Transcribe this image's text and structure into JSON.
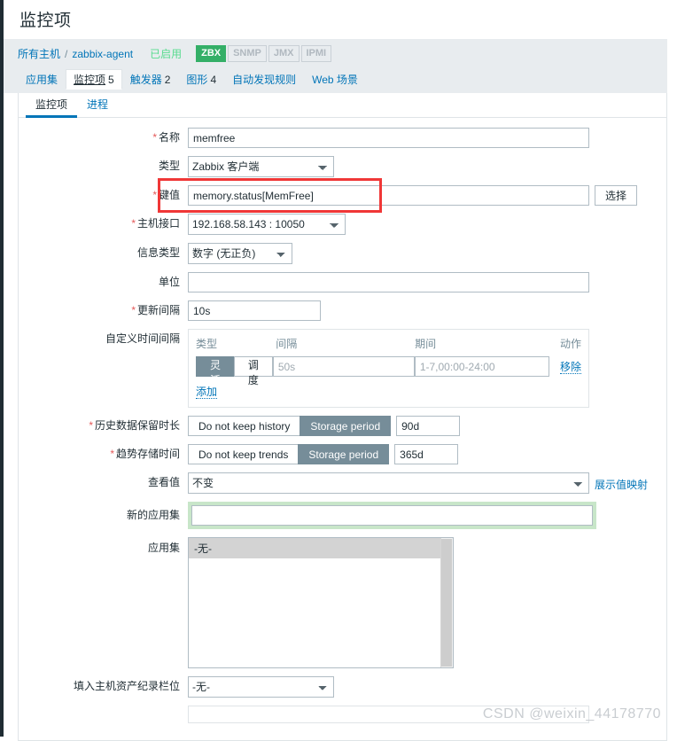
{
  "page": {
    "title": "监控项"
  },
  "breadcrumb": {
    "all_hosts": "所有主机",
    "separator": "/",
    "host": "zabbix-agent",
    "status": "已启用",
    "tags": [
      {
        "label": "ZBX",
        "active": true
      },
      {
        "label": "SNMP",
        "active": false
      },
      {
        "label": "JMX",
        "active": false
      },
      {
        "label": "IPMI",
        "active": false
      }
    ]
  },
  "nav_tabs": [
    {
      "label": "应用集",
      "count": "",
      "selected": false
    },
    {
      "label": "监控项",
      "count": "5",
      "selected": true
    },
    {
      "label": "触发器",
      "count": "2",
      "selected": false
    },
    {
      "label": "图形",
      "count": "4",
      "selected": false
    },
    {
      "label": "自动发现规则",
      "count": "",
      "selected": false
    },
    {
      "label": "Web 场景",
      "count": "",
      "selected": false
    }
  ],
  "form_tabs": [
    {
      "label": "监控项",
      "active": true
    },
    {
      "label": "进程",
      "active": false
    }
  ],
  "form": {
    "name": {
      "label": "名称",
      "required": true,
      "value": "memfree"
    },
    "type": {
      "label": "类型",
      "required": false,
      "value": "Zabbix 客户端"
    },
    "key": {
      "label": "键值",
      "required": true,
      "value": "memory.status[MemFree]",
      "select_button": "选择",
      "highlighted": true,
      "highlight_color": "#f03737"
    },
    "host_interface": {
      "label": "主机接口",
      "required": true,
      "value": "192.168.58.143 : 10050"
    },
    "info_type": {
      "label": "信息类型",
      "required": false,
      "value": "数字 (无正负)"
    },
    "units": {
      "label": "单位",
      "required": false,
      "value": ""
    },
    "update_interval": {
      "label": "更新间隔",
      "required": true,
      "value": "10s"
    },
    "custom_intervals": {
      "label": "自定义时间间隔",
      "columns": {
        "type": "类型",
        "interval": "间隔",
        "period": "期间",
        "action": "动作"
      },
      "rows": [
        {
          "type_flexible": "灵活",
          "type_scheduling": "调度",
          "type_selected": "灵活",
          "interval_value": "",
          "interval_placeholder": "50s",
          "period_value": "",
          "period_placeholder": "1-7,00:00-24:00",
          "remove_label": "移除"
        }
      ],
      "add_label": "添加"
    },
    "history": {
      "label": "历史数据保留时长",
      "required": true,
      "option_off": "Do not keep history",
      "option_on": "Storage period",
      "selected": "Storage period",
      "value": "90d"
    },
    "trends": {
      "label": "趋势存储时间",
      "required": true,
      "option_off": "Do not keep trends",
      "option_on": "Storage period",
      "selected": "Storage period",
      "value": "365d"
    },
    "value_map": {
      "label": "查看值",
      "value": "不变",
      "link_label": "展示值映射"
    },
    "new_application": {
      "label": "新的应用集",
      "value": "",
      "highlighted": true,
      "highlight_color": "#c8e6c9"
    },
    "applications": {
      "label": "应用集",
      "options": [
        "-无-"
      ],
      "selected": "-无-"
    },
    "inventory_field": {
      "label": "填入主机资产纪录栏位",
      "value": "-无-"
    }
  },
  "watermark": "CSDN @weixin_44178770",
  "colors": {
    "accent_blue": "#0275b8",
    "rail_navy": "#1f2c33",
    "header_band": "#e8ecef",
    "badge_green": "#34af67",
    "status_green": "#59db8f",
    "required_red": "#e45959",
    "segment_on": "#768d99"
  }
}
